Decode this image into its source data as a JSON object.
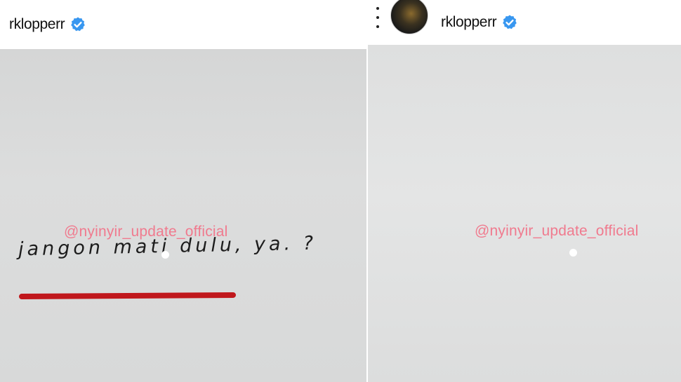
{
  "left_post": {
    "username": "rklopperr",
    "handwritten_text": "jangon mati dulu, ya. ?",
    "watermark": "@nyinyir_update_official"
  },
  "right_post": {
    "username": "rklopperr",
    "watermark": "@nyinyir_update_official"
  },
  "colors": {
    "verified_badge": "#3897f0",
    "watermark": "#f07a8e",
    "underline": "#c0171c"
  },
  "icons": {
    "verified": "verified-badge-icon",
    "more": "more-vertical-icon"
  }
}
